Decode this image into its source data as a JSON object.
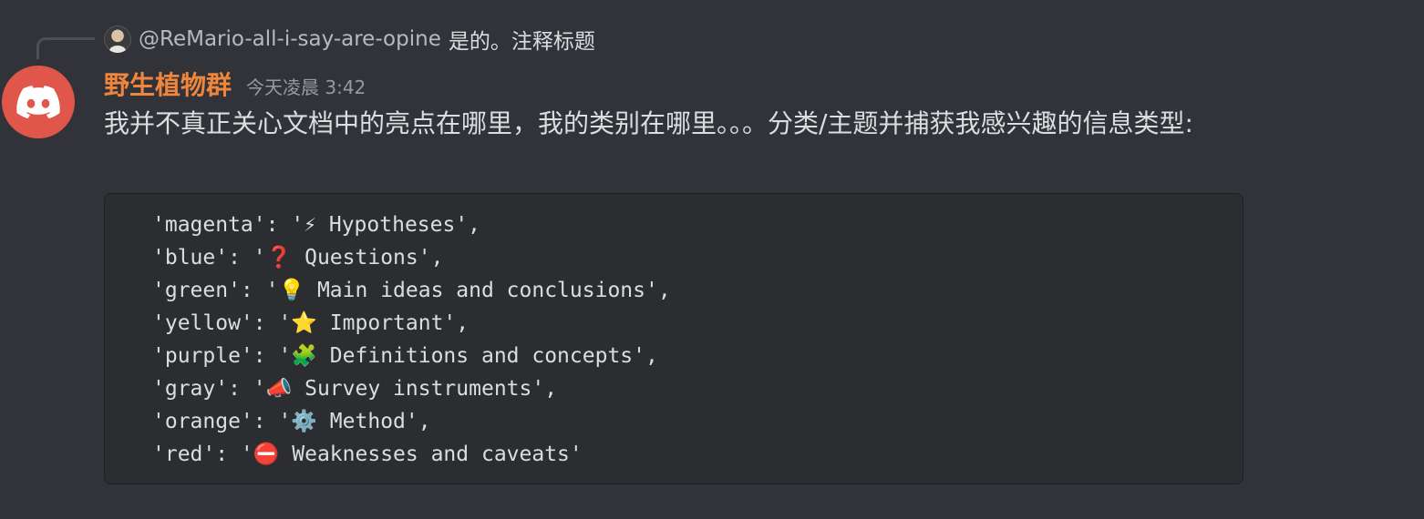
{
  "reply": {
    "author": "@ReMario-all-i-say-are-opine",
    "text": "是的。注释标题"
  },
  "message": {
    "username": "野生植物群",
    "timestamp": "今天凌晨 3:42",
    "text": "我并不真正关心文档中的亮点在哪里，我的类别在哪里。。。分类/主题并捕获我感兴趣的信息类型:",
    "code_lines": [
      "'magenta': '⚡ Hypotheses',",
      "'blue': '❓ Questions',",
      "'green': '💡 Main ideas and conclusions',",
      "'yellow': '⭐ Important',",
      "'purple': '🧩 Definitions and concepts',",
      "'gray': '📣 Survey instruments',",
      "'orange': '⚙️ Method',",
      "'red': '⛔ Weaknesses and caveats'"
    ]
  },
  "icons": {
    "avatar": "discord-logo-icon",
    "reply_avatar": "user-avatar"
  },
  "colors": {
    "background": "#313338",
    "username": "#f0863b",
    "avatar_bg": "#e0564a",
    "code_bg": "#2b2d31"
  }
}
